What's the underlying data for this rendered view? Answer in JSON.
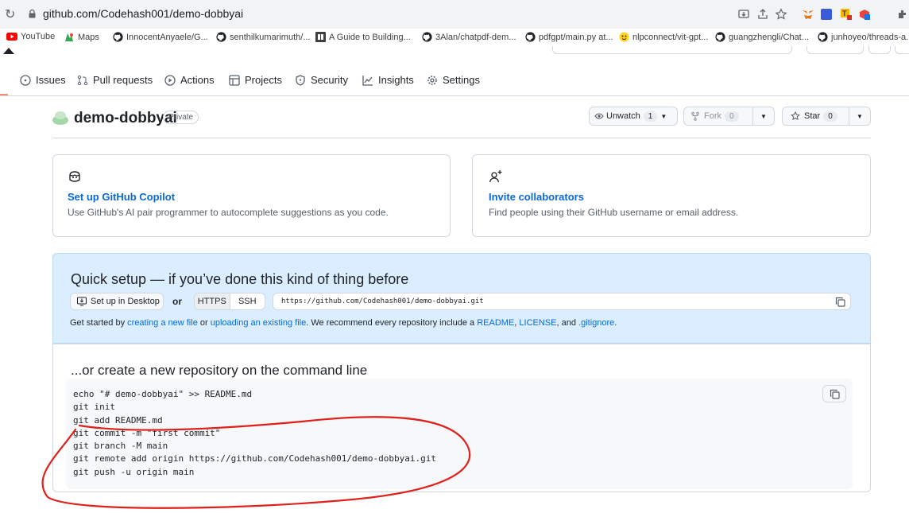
{
  "browser": {
    "url": "github.com/Codehash001/demo-dobbyai",
    "bookmarks": [
      {
        "label": "YouTube",
        "icon": "youtube-icon"
      },
      {
        "label": "Maps",
        "icon": "maps-icon"
      },
      {
        "label": "InnocentAnyaele/G...",
        "icon": "github-icon"
      },
      {
        "label": "senthilkumarimuth/...",
        "icon": "github-icon"
      },
      {
        "label": "A Guide to Building...",
        "icon": "page-icon"
      },
      {
        "label": "3Alan/chatpdf-dem...",
        "icon": "github-icon"
      },
      {
        "label": "pdfgpt/main.py at...",
        "icon": "github-icon"
      },
      {
        "label": "nlpconnect/vit-gpt...",
        "icon": "huggingface-icon"
      },
      {
        "label": "guangzhengli/Chat...",
        "icon": "github-icon"
      },
      {
        "label": "junhoyeo/threads-a...",
        "icon": "github-icon"
      }
    ]
  },
  "repo_nav": {
    "items": [
      {
        "label": "Issues",
        "icon": "issue-icon"
      },
      {
        "label": "Pull requests",
        "icon": "pull-request-icon"
      },
      {
        "label": "Actions",
        "icon": "play-icon"
      },
      {
        "label": "Projects",
        "icon": "table-icon"
      },
      {
        "label": "Security",
        "icon": "shield-icon"
      },
      {
        "label": "Insights",
        "icon": "graph-icon"
      },
      {
        "label": "Settings",
        "icon": "gear-icon"
      }
    ]
  },
  "repo": {
    "name": "demo-dobbyai",
    "visibility": "Private",
    "unwatch_label": "Unwatch",
    "watch_count": "1",
    "fork_label": "Fork",
    "fork_count": "0",
    "star_label": "Star",
    "star_count": "0"
  },
  "cards": {
    "copilot": {
      "title": "Set up GitHub Copilot",
      "desc": "Use GitHub's AI pair programmer to autocomplete suggestions as you code."
    },
    "collaborators": {
      "title": "Invite collaborators",
      "desc": "Find people using their GitHub username or email address."
    }
  },
  "quick_setup": {
    "title": "Quick setup — if you’ve done this kind of thing before",
    "desktop_button": "Set up in Desktop",
    "or": "or",
    "https": "HTTPS",
    "ssh": "SSH",
    "clone_url": "https://github.com/Codehash001/demo-dobbyai.git",
    "get_started": {
      "prefix": "Get started by ",
      "link1": "creating a new file",
      "mid1": " or ",
      "link2": "uploading an existing file",
      "mid2": ". We recommend every repository include a ",
      "link3": "README",
      "sep1": ", ",
      "link4": "LICENSE",
      "sep2": ", and ",
      "link5": ".gitignore",
      "suffix": "."
    }
  },
  "command_line": {
    "title": "...or create a new repository on the command line",
    "lines": [
      "echo \"# demo-dobbyai\" >> README.md",
      "git init",
      "git add README.md",
      "git commit -m \"first commit\"",
      "git branch -M main",
      "git remote add origin https://github.com/Codehash001/demo-dobbyai.git",
      "git push -u origin main"
    ]
  },
  "colors": {
    "accent_link": "#0969da",
    "quick_setup_bg": "#dbeeff",
    "annotation_red": "#e0201a"
  }
}
